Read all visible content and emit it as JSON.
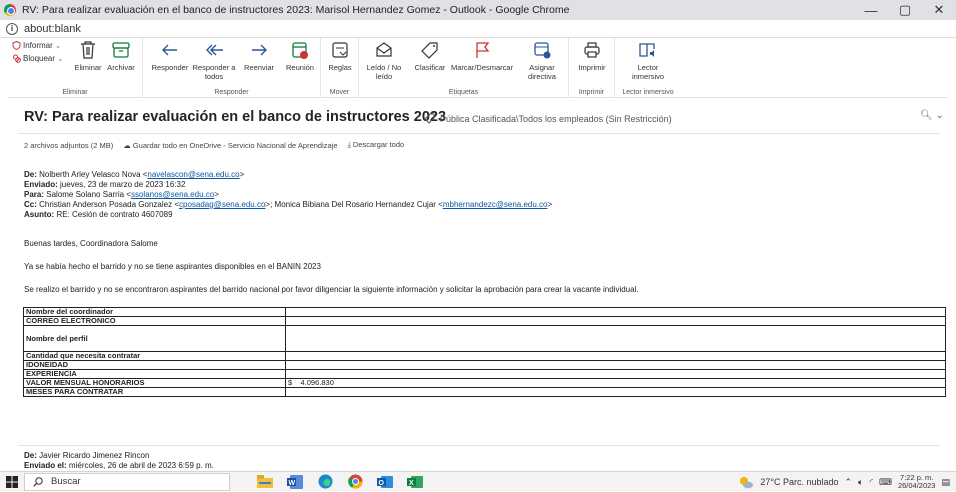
{
  "window": {
    "title": "RV: Para realizar evaluación en el banco de instructores 2023: Marisol Hernandez Gomez - Outlook - Google Chrome",
    "minimize": "—",
    "maximize": "▢",
    "close": "✕",
    "address": "about:blank"
  },
  "ribbon": {
    "report": "Informar",
    "block": "Bloquear",
    "delete": "Eliminar",
    "archive": "Archivar",
    "reply": "Responder",
    "reply_all": "Responder a todos",
    "forward": "Reenviar",
    "meeting": "Reunión",
    "rules": "Reglas",
    "read_unread": "Leído / No leído",
    "classify": "Clasificar",
    "flag": "Marcar/Desmarcar",
    "assign_policy": "Asignar directiva",
    "print": "Imprimir",
    "immersive_reader": "Lector inmersivo",
    "groups": {
      "delete": "Eliminar",
      "respond": "Responder",
      "move": "Mover",
      "tags": "Etiquetas",
      "print": "Imprimir",
      "immersive": "Lector inmersivo"
    }
  },
  "message": {
    "subject": "RV: Para realizar evaluación en el banco de instructores 2023",
    "classification": "Pública Clasificada\\Todos los empleados (Sin Restricción)",
    "attachments": {
      "count": "2 archivos adjuntos (2 MB)",
      "save_onedrive": "Guardar todo en OneDrive - Servicio Nacional de Aprendizaje",
      "download_all": "Descargar todo"
    },
    "header": {
      "from_label": "De:",
      "from_name": "Nolberth Arley Velasco Nova <",
      "from_email": "navelascon@sena.edu.co",
      "from_end": ">",
      "sent_label": "Enviado:",
      "sent_value": "jueves, 23 de marzo de 2023 16:32",
      "to_label": "Para:",
      "to_name": "Salome Solano Sarria <",
      "to_email": "ssolanos@sena.edu.co",
      "to_end": ">",
      "cc_label": "Cc:",
      "cc_name1": "Christian Anderson Posada Gonzalez <",
      "cc_email1": "cposadag@sena.edu.co",
      "cc_mid": ">; Monica Bibiana Del Rosario Hernandez Cujar <",
      "cc_email2": "mbhernandezc@sena.edu.co",
      "cc_end": ">",
      "subject_label": "Asunto:",
      "subject_value": "RE: Cesión de contrato 4607089"
    },
    "greeting": "Buenas tardes, Coordinadora Salome",
    "line1": "Ya se había hecho el barrido y no se tiene aspirantes disponibles en el BANIN 2023",
    "line2": "Se realizo el barrido y no se encontraron aspirantes del barrido nacional por favor diligenciar la siguiente información y solicitar la aprobación para crear la vacante individual.",
    "table": [
      {
        "label": "Nombre del coordinador",
        "value": ""
      },
      {
        "label": "CORREO ELECTRONICO",
        "value": ""
      },
      {
        "label": "Nombre del perfil",
        "value": ""
      },
      {
        "label": "Cantidad que necesita contratar",
        "value": ""
      },
      {
        "label": "IDONEIDAD",
        "value": ""
      },
      {
        "label": "EXPERIENCIA",
        "value": ""
      },
      {
        "label": "VALOR MENSUAL HONORARIOS",
        "value": "$    4.096.830"
      },
      {
        "label": "MESES PARA CONTRATAR",
        "value": ""
      }
    ],
    "prev": {
      "from_label": "De:",
      "from_value": "Javier Ricardo Jimenez Rincon",
      "sent_label": "Enviado el:",
      "sent_value": "miércoles, 26 de abril de 2023 6:59 p. m."
    }
  },
  "taskbar": {
    "search": "Buscar",
    "weather": "27°C  Parc. nublado",
    "time": "7:22 p. m.",
    "date": "26/04/2023"
  }
}
